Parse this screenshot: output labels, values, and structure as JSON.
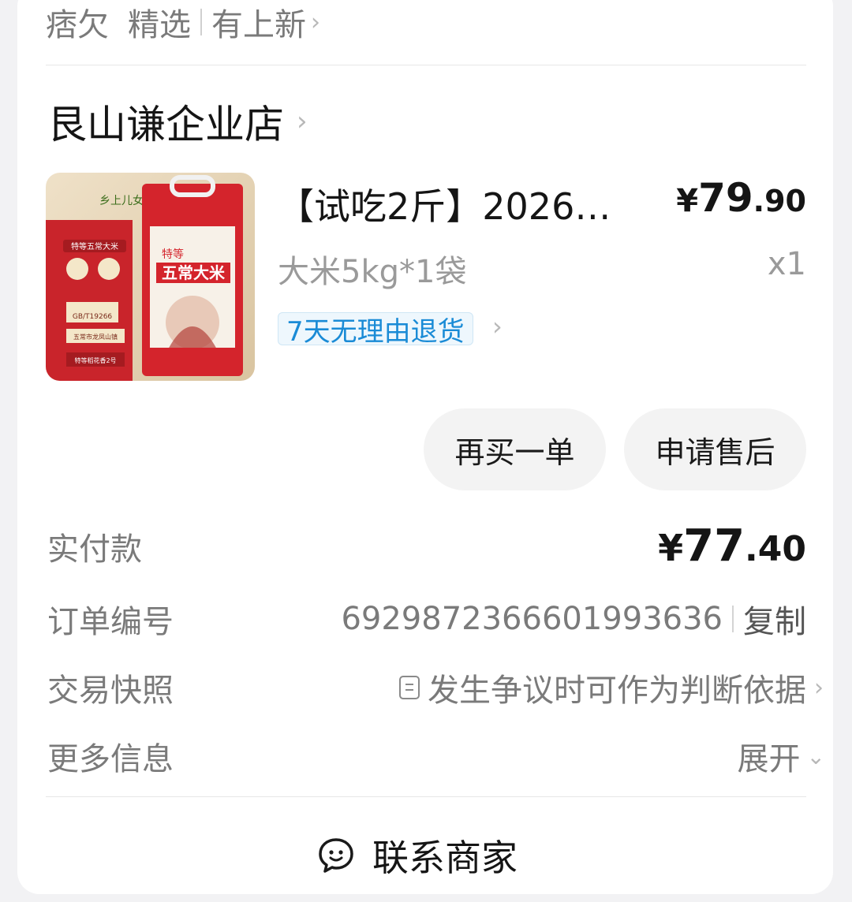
{
  "top": {
    "tabs": [
      "痞欠",
      "精选"
    ],
    "link": "有上新"
  },
  "shop": {
    "name": "艮山谦企业店"
  },
  "product": {
    "title": "【试吃2斤】2026…",
    "price_currency": "¥",
    "price_int": "79",
    "price_dec": ".90",
    "spec": "大米5kg*1袋",
    "qty": "x1",
    "tag": "7天无理由退货",
    "image_texts": {
      "brand": "乡上儿女",
      "name": "五常大米",
      "grade": "特等",
      "side1": "特等五常大米",
      "std": "GB/T19266",
      "place": "五常市龙凤山镇",
      "variety": "特等稻花香2号"
    }
  },
  "actions": {
    "rebuy": "再买一单",
    "after_sale": "申请售后"
  },
  "details": {
    "paid_label": "实付款",
    "paid_currency": "¥",
    "paid_int": "77",
    "paid_dec": ".40",
    "order_label": "订单编号",
    "order_no": "6929872366601993636",
    "copy": "复制",
    "snapshot_label": "交易快照",
    "snapshot_value": "发生争议时可作为判断依据",
    "more_label": "更多信息",
    "more_value": "展开"
  },
  "contact": {
    "label": "联系商家"
  },
  "colors": {
    "tag_blue": "#1a8bd6",
    "package_red": "#d4242c",
    "button_bg": "#f3f3f3"
  }
}
